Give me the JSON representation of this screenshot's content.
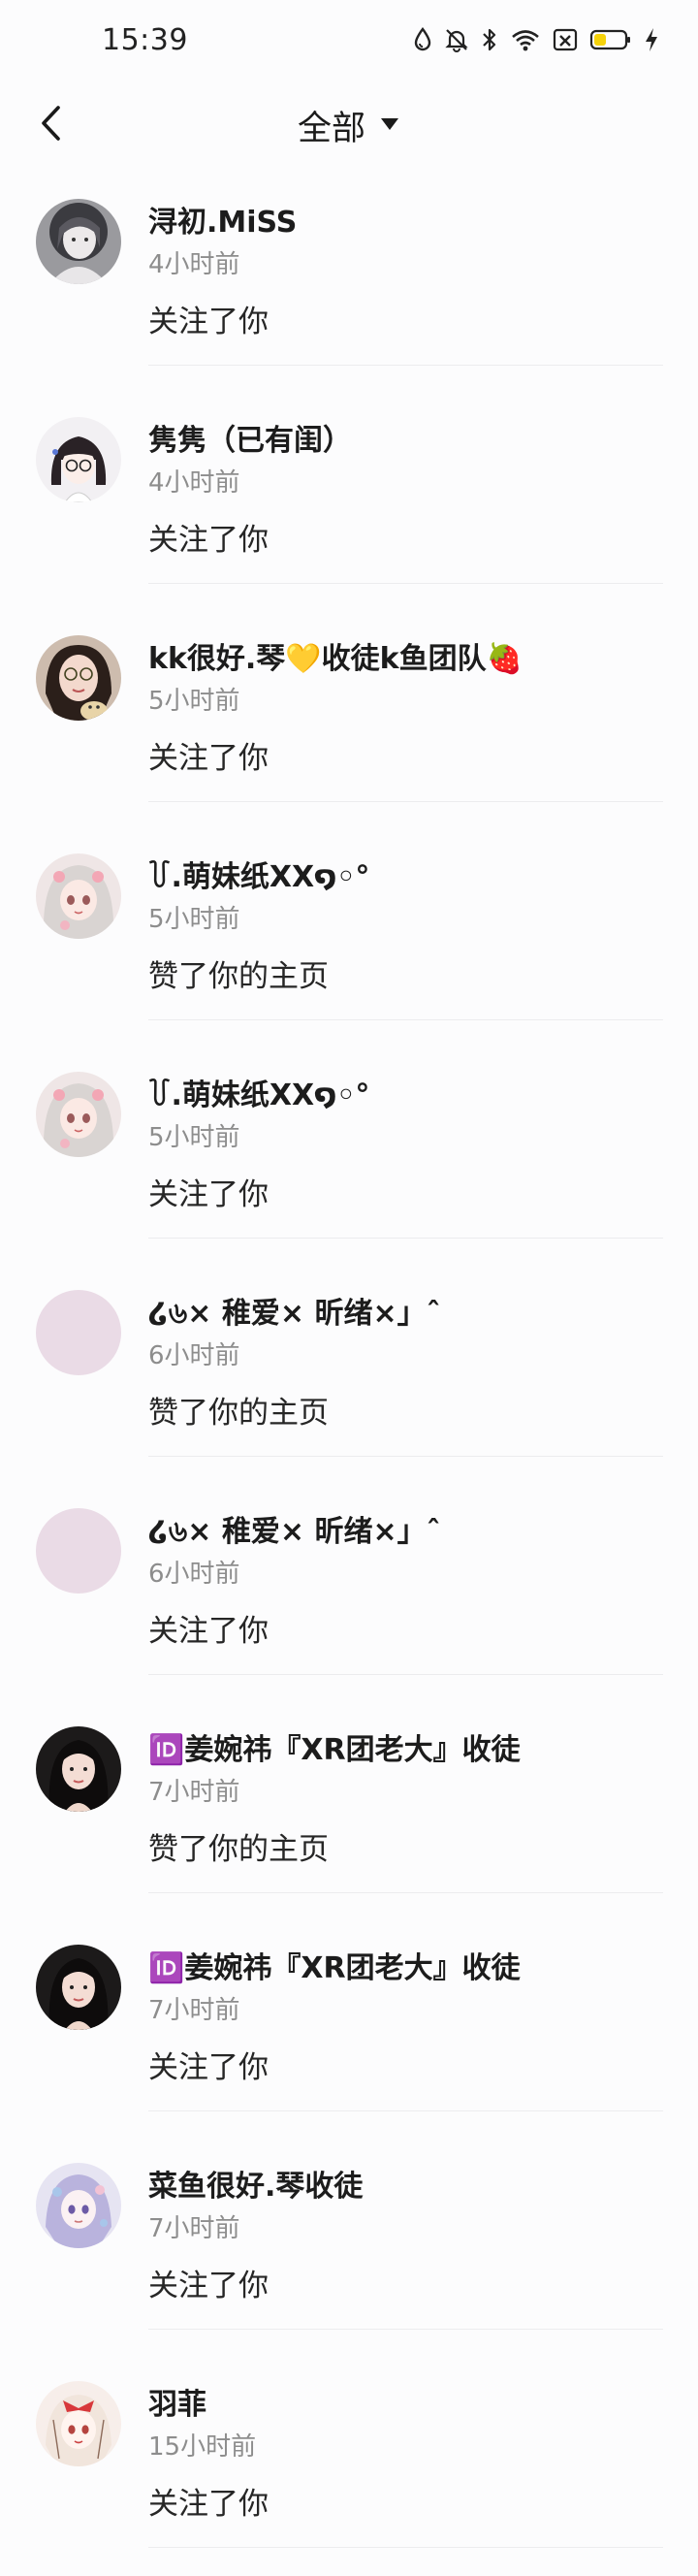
{
  "status_bar": {
    "time": "15:39",
    "icons": [
      "water-drop-icon",
      "bell-off-icon",
      "bluetooth-icon",
      "wifi-icon",
      "sim-off-icon",
      "battery-icon",
      "charging-bolt-icon"
    ],
    "battery_color": "#f5d20a"
  },
  "nav": {
    "title": "全部",
    "back_icon": "chevron-left-icon",
    "dropdown_icon": "caret-down-icon"
  },
  "notifications": [
    {
      "name": "浔初.MiSS",
      "time": "4小时前",
      "action": "关注了你",
      "avatar": "girl-portrait-grey"
    },
    {
      "name": "隽隽（已有闺）",
      "time": "4小时前",
      "action": "关注了你",
      "avatar": "girl-cartoon-glasses"
    },
    {
      "name": "kk很好.琴💛收徒k鱼团队🍓",
      "time": "5小时前",
      "action": "关注了你",
      "avatar": "girl-photo-cat"
    },
    {
      "name": "꒦.萌妹纸XX໑◦°",
      "time": "5小时前",
      "action": "赞了你的主页",
      "avatar": "anime-girl-pink"
    },
    {
      "name": "꒦.萌妹纸XX໑◦°",
      "time": "5小时前",
      "action": "关注了你",
      "avatar": "anime-girl-pink"
    },
    {
      "name": "໒৬× 稚爱× 昕绪×」ˆ",
      "time": "6小时前",
      "action": "赞了你的主页",
      "avatar": "blank-lilac"
    },
    {
      "name": "໒৬× 稚爱× 昕绪×」ˆ",
      "time": "6小时前",
      "action": "关注了你",
      "avatar": "blank-lilac"
    },
    {
      "name": "🆔姜婉祎『XR团老大』收徒",
      "time": "7小时前",
      "action": "赞了你的主页",
      "avatar": "girl-photo-dark"
    },
    {
      "name": "🆔姜婉祎『XR团老大』收徒",
      "time": "7小时前",
      "action": "关注了你",
      "avatar": "girl-photo-dark"
    },
    {
      "name": "菜鱼很好.琴收徒",
      "time": "7小时前",
      "action": "关注了你",
      "avatar": "anime-girl-lavender"
    },
    {
      "name": "羽菲",
      "time": "15小时前",
      "action": "关注了你",
      "avatar": "anime-girl-red-bow"
    }
  ]
}
